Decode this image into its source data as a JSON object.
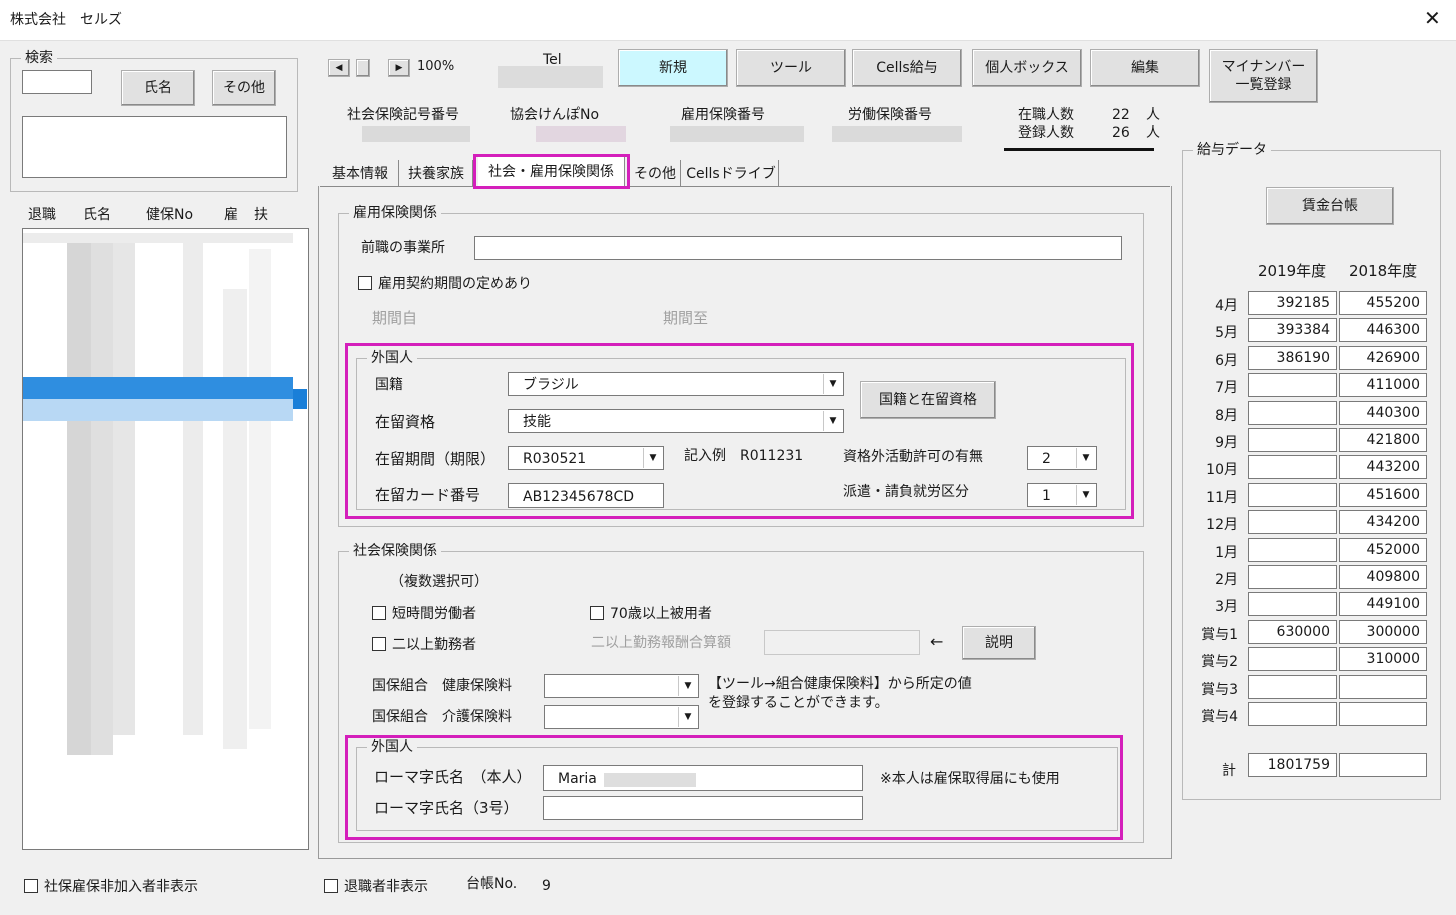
{
  "window": {
    "title": "株式会社　セルズ",
    "close_icon": "close-icon"
  },
  "search": {
    "group_label": "検索",
    "input_value": "",
    "name_button": "氏名",
    "other_button": "その他",
    "text_area": ""
  },
  "list": {
    "headers": [
      "退職",
      "氏名",
      "健保No",
      "雇",
      "扶"
    ],
    "hide_non_insured_label": "社保雇保非加入者非表示"
  },
  "nav": {
    "zoom": "100%",
    "tel_label": "Tel"
  },
  "toolbar": {
    "new": "新規",
    "tools": "ツール",
    "cells_salary": "Cells給与",
    "personal_box": "個人ボックス",
    "edit": "編集",
    "my_number": "マイナンバー\n一覧登録"
  },
  "info": {
    "social_insurance_no": "社会保険記号番号",
    "kyokai_kenpo_no": "協会けんぽNo",
    "employment_insurance_no": "雇用保険番号",
    "labor_insurance_no": "労働保険番号",
    "employees_label": "在職人数",
    "employees_value": "22",
    "registered_label": "登録人数",
    "registered_value": "26",
    "unit": "人"
  },
  "tabs": [
    "基本情報",
    "扶養家族",
    "社会・雇用保険関係",
    "その他",
    "Cellsドライブ"
  ],
  "employment": {
    "group_label": "雇用保険関係",
    "prev_office_label": "前職の事業所",
    "prev_office_value": "",
    "contract_period_label": "雇用契約期間の定めあり",
    "period_from": "期間自",
    "period_to": "期間至"
  },
  "foreigner1": {
    "group_label": "外国人",
    "nationality_label": "国籍",
    "nationality_value": "ブラジル",
    "status_label": "在留資格",
    "status_value": "技能",
    "period_label": "在留期間（期限）",
    "period_value": "R030521",
    "example_label": "記入例　R011231",
    "card_label": "在留カード番号",
    "card_value": "AB12345678CD",
    "nationality_button": "国籍と在留資格",
    "permission_label": "資格外活動許可の有無",
    "permission_value": "2",
    "dispatch_label": "派遣・請負就労区分",
    "dispatch_value": "1"
  },
  "social": {
    "group_label": "社会保険関係",
    "multi_select": "（複数選択可）",
    "short_time": "短時間労働者",
    "over70": "70歳以上被用者",
    "multi_work": "二以上勤務者",
    "multi_pay_label": "二以上勤務報酬合算額",
    "multi_pay_value": "",
    "arrow": "←",
    "explain_button": "説明",
    "health_label": "国保組合　健康保険料",
    "care_label": "国保組合　介護保険料",
    "note_line1": "【ツール→組合健康保険料】から所定の値",
    "note_line2": "を登録することができます。"
  },
  "foreigner2": {
    "group_label": "外国人",
    "roman_self_label": "ローマ字氏名　（本人）",
    "roman_self_value": "Maria",
    "roman_no3_label": "ローマ字氏名（3号）",
    "roman_no3_value": "",
    "note": "※本人は雇保取得届にも使用"
  },
  "salary": {
    "group_label": "給与データ",
    "ledger_button": "賃金台帳",
    "year1": "2019年度",
    "year2": "2018年度",
    "rows": [
      {
        "month": "4月",
        "y1": "392185",
        "y2": "455200"
      },
      {
        "month": "5月",
        "y1": "393384",
        "y2": "446300"
      },
      {
        "month": "6月",
        "y1": "386190",
        "y2": "426900"
      },
      {
        "month": "7月",
        "y1": "",
        "y2": "411000"
      },
      {
        "month": "8月",
        "y1": "",
        "y2": "440300"
      },
      {
        "month": "9月",
        "y1": "",
        "y2": "421800"
      },
      {
        "month": "10月",
        "y1": "",
        "y2": "443200"
      },
      {
        "month": "11月",
        "y1": "",
        "y2": "451600"
      },
      {
        "month": "12月",
        "y1": "",
        "y2": "434200"
      },
      {
        "month": "1月",
        "y1": "",
        "y2": "452000"
      },
      {
        "month": "2月",
        "y1": "",
        "y2": "409800"
      },
      {
        "month": "3月",
        "y1": "",
        "y2": "449100"
      },
      {
        "month": "賞与1",
        "y1": "630000",
        "y2": "300000"
      },
      {
        "month": "賞与2",
        "y1": "",
        "y2": "310000"
      },
      {
        "month": "賞与3",
        "y1": "",
        "y2": ""
      },
      {
        "month": "賞与4",
        "y1": "",
        "y2": ""
      }
    ],
    "total_label": "計",
    "total_y1": "1801759",
    "total_y2": ""
  },
  "footer": {
    "retired_hide_label": "退職者非表示",
    "ledger_no_label": "台帳No.",
    "ledger_no_value": "9"
  },
  "colors": {
    "highlight": "#d41fbb",
    "active_tab_btn": "#ccf8ff",
    "selection": "#2f8ee0"
  }
}
